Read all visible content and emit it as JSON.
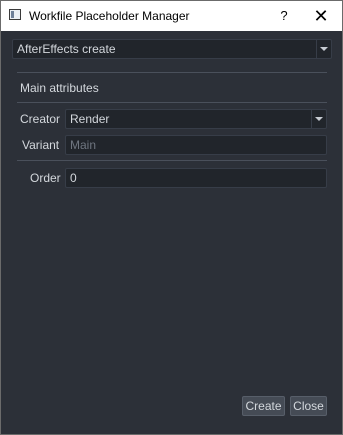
{
  "window": {
    "title": "Workfile Placeholder Manager",
    "help_label": "?",
    "close_label": "✕"
  },
  "placeholder_type": {
    "selected": "AfterEffects create"
  },
  "main_attributes": {
    "heading": "Main attributes",
    "creator_label": "Creator",
    "creator_value": "Render",
    "variant_label": "Variant",
    "variant_placeholder": "Main",
    "variant_value": ""
  },
  "options": {
    "order_label": "Order",
    "order_value": "0"
  },
  "footer": {
    "create_label": "Create",
    "close_label": "Close"
  },
  "icons": {
    "window": "app-window-icon",
    "dropdown": "chevron-down-icon"
  },
  "colors": {
    "background": "#2c3038",
    "field_background": "#21252b",
    "text": "#d4d8dd",
    "placeholder_text": "#6f7680",
    "button_background": "#454b55"
  }
}
